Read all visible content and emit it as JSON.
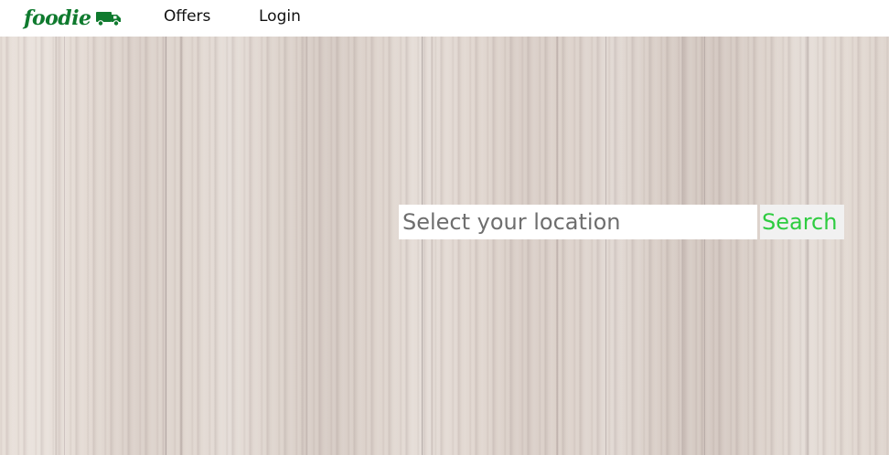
{
  "header": {
    "logo_text": "foodie",
    "logo_icon": "truck-icon",
    "nav": {
      "offers_label": "Offers",
      "login_label": "Login"
    }
  },
  "search": {
    "placeholder": "Select your location",
    "value": "",
    "button_label": "Search"
  },
  "colors": {
    "brand_green": "#0f7a2e",
    "search_button_text": "#2ecc40",
    "header_background": "#ffffff"
  }
}
